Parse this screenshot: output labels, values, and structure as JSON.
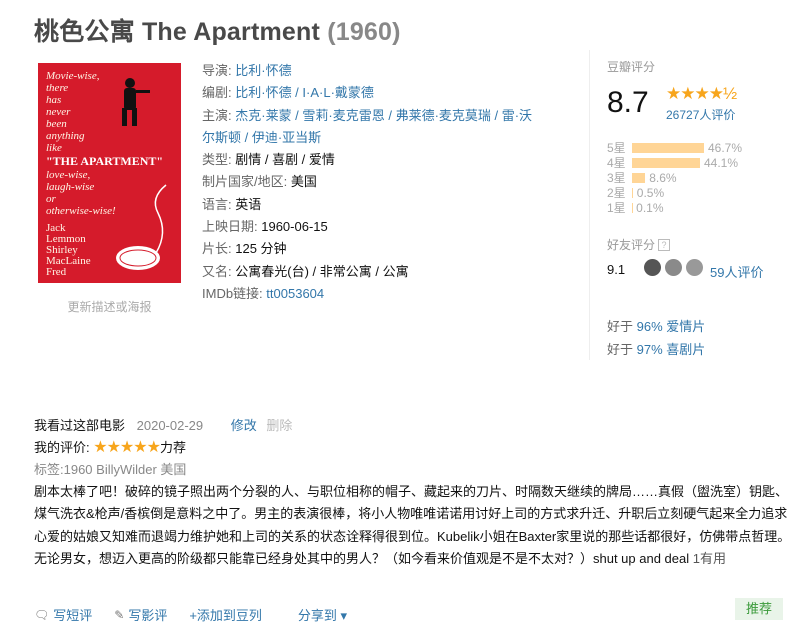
{
  "title": "桃色公寓 The Apartment",
  "year": "(1960)",
  "poster": {
    "caption": "更新描述或海报",
    "tagline": "Movie-wise, there has never been anything like",
    "movie_name": "\"THE APARTMENT\"",
    "tagline2": "love-wise, laugh-wise or otherwise-wise!",
    "cast": "Jack Lemmon Shirley MacLaine Fred MacMurray"
  },
  "info": {
    "director_label": "导演: ",
    "director": "比利·怀德",
    "writer_label": "编剧: ",
    "writers": "比利·怀德 / I·A·L·戴蒙德",
    "cast_label": "主演: ",
    "cast_line1": "杰克·莱蒙 / 雪莉·麦克雷恩 / 弗莱德·麦克莫瑞 / 雷·沃",
    "cast_line2": "尔斯顿 / 伊迪·亚当斯",
    "genre_label": "类型: ",
    "genre": "剧情 / 喜剧 / 爱情",
    "country_label": "制片国家/地区: ",
    "country": "美国",
    "language_label": "语言: ",
    "language": "英语",
    "release_label": "上映日期: ",
    "release": "1960-06-15",
    "runtime_label": "片长: ",
    "runtime": "125 分钟",
    "aka_label": "又名: ",
    "aka": "公寓春光(台) / 非常公寓 / 公寓",
    "imdb_label": "IMDb链接: ",
    "imdb": "tt0053604"
  },
  "rating": {
    "header": "豆瓣评分",
    "score": "8.7",
    "stars": "★★★★½",
    "count": "26727人评价",
    "distribution": [
      {
        "label": "5星",
        "pct": "46.7%",
        "value": 46.7
      },
      {
        "label": "4星",
        "pct": "44.1%",
        "value": 44.1
      },
      {
        "label": "3星",
        "pct": "8.6%",
        "value": 8.6
      },
      {
        "label": "2星",
        "pct": "0.5%",
        "value": 0.5
      },
      {
        "label": "1星",
        "pct": "0.1%",
        "value": 0.1
      }
    ],
    "friend_header": "好友评分",
    "friend_help": "?",
    "friend_score": "9.1",
    "friend_count": "59人评价",
    "better1_prefix": "好于 ",
    "better1_pct": "96% 爱情片",
    "better2_prefix": "好于 ",
    "better2_pct": "97% 喜剧片"
  },
  "my_review": {
    "watched": "我看过这部电影",
    "date": "2020-02-29",
    "edit": "修改",
    "delete": "删除",
    "my_rating_label": "我的评价: ",
    "my_stars": "★★★★★",
    "recommend_word": "力荐",
    "tags": "标签:1960 BillyWilder 美国",
    "body": "剧本太棒了吧！破碎的镜子照出两个分裂的人、与职位相称的帽子、藏起来的刀片、时隔数天继续的牌局……真假（盥洗室）钥匙、煤气洗衣&枪声/香槟倒是意料之中了。男主的表演很棒，将小人物唯唯诺诺用讨好上司的方式求升迁、升职后立刻硬气起来全力追求心爱的姑娘又知难而退竭力维护她和上司的关系的状态诠释得很到位。Kubelik小姐在Baxter家里说的那些话都很好，仿佛带点哲理。无论男女，想迈入更高的阶级都只能靠已经身处其中的男人？（如今看来价值观是不是不太对？）shut up and deal ",
    "useful": "1有用"
  },
  "actions": {
    "short_review": "写短评",
    "long_review": "写影评",
    "add_doulist": "+添加到豆列",
    "share": "分享到 ▾",
    "recommend": "推荐"
  }
}
